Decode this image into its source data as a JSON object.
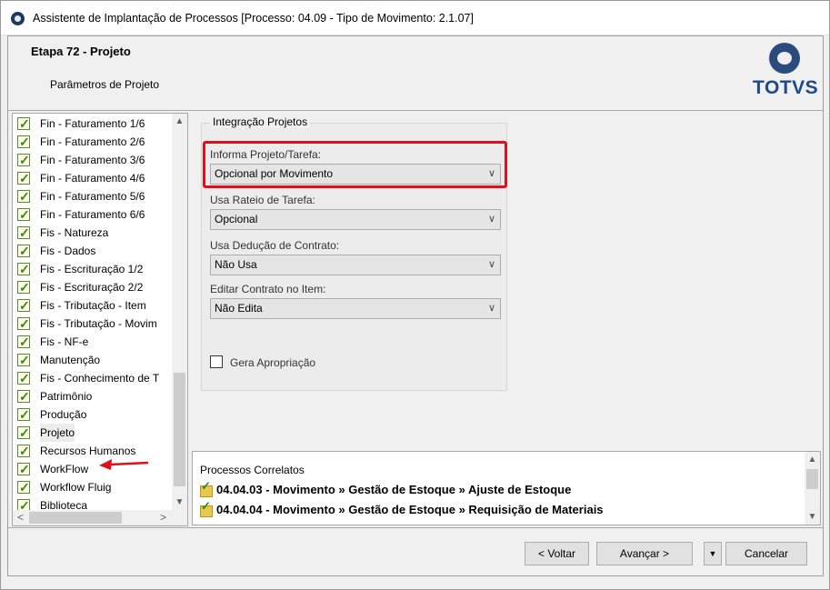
{
  "window": {
    "title": "Assistente de Implantação de Processos [Processo: 04.09 - Tipo de Movimento: 2.1.07]"
  },
  "header": {
    "step_title": "Etapa 72 - Projeto",
    "step_subtitle": "Parâmetros de Projeto",
    "logo_text": "TOTVS"
  },
  "sidebar": {
    "items": [
      {
        "label": "Fin - Faturamento 1/6"
      },
      {
        "label": "Fin - Faturamento 2/6"
      },
      {
        "label": "Fin - Faturamento 3/6"
      },
      {
        "label": "Fin - Faturamento 4/6"
      },
      {
        "label": "Fin - Faturamento 5/6"
      },
      {
        "label": "Fin - Faturamento 6/6"
      },
      {
        "label": "Fis - Natureza"
      },
      {
        "label": "Fis - Dados"
      },
      {
        "label": "Fis - Escrituração 1/2"
      },
      {
        "label": "Fis - Escrituração 2/2"
      },
      {
        "label": "Fis - Tributação - Item"
      },
      {
        "label": "Fis - Tributação - Movim"
      },
      {
        "label": "Fis - NF-e"
      },
      {
        "label": "Manutenção"
      },
      {
        "label": "Fis - Conhecimento de T"
      },
      {
        "label": "Patrimônio"
      },
      {
        "label": "Produção"
      },
      {
        "label": "Projeto"
      },
      {
        "label": "Recursos Humanos"
      },
      {
        "label": "WorkFlow"
      },
      {
        "label": "Workflow Fluig"
      },
      {
        "label": "Biblioteca"
      }
    ],
    "selected": "Projeto",
    "scroll_up": "▲",
    "scroll_down": "▼",
    "scroll_left": "<",
    "scroll_right": ">"
  },
  "integracao": {
    "legend": "Integração Projetos",
    "informa_projeto": {
      "label": "Informa Projeto/Tarefa:",
      "value": "Opcional por Movimento"
    },
    "usa_rateio": {
      "label": "Usa Rateio de Tarefa:",
      "value": "Opcional"
    },
    "usa_deducao": {
      "label": "Usa Dedução de Contrato:",
      "value": "Não Usa"
    },
    "editar_contrato": {
      "label": "Editar Contrato no Item:",
      "value": "Não Edita"
    },
    "gera_apropriacao": {
      "label": "Gera Apropriação",
      "checked": false
    },
    "highlight_color": "#e0101a"
  },
  "correlatos": {
    "title": "Processos Correlatos",
    "rows": [
      {
        "text": "04.04.03 - Movimento » Gestão de Estoque » Ajuste de Estoque"
      },
      {
        "text": "04.04.04 - Movimento » Gestão de Estoque » Requisição de Materiais"
      }
    ]
  },
  "footer": {
    "back_label": "< Voltar",
    "next_label": "Avançar >",
    "more_label": "▼",
    "cancel_label": "Cancelar"
  },
  "icons": {
    "app": "totvs-app-icon",
    "check": "check-icon",
    "process": "process-icon",
    "arrow": "red-arrow-icon"
  }
}
